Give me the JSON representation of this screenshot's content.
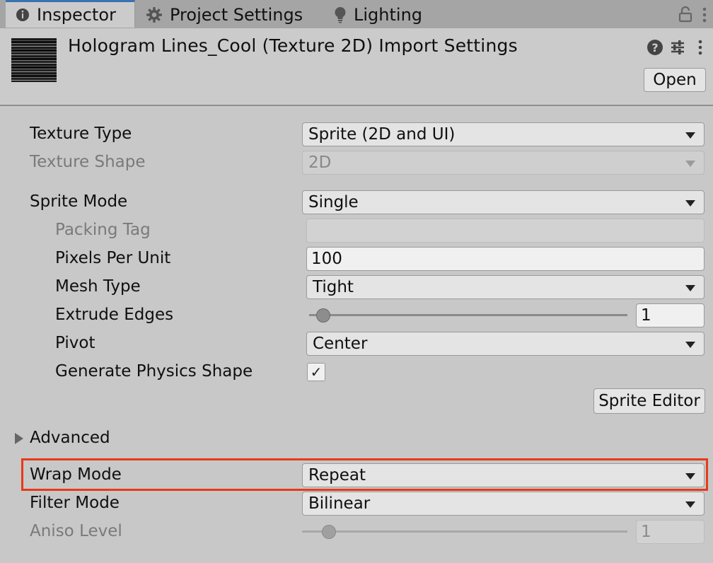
{
  "tabs": [
    {
      "label": "Inspector",
      "icon": "info-icon"
    },
    {
      "label": "Project Settings",
      "icon": "gear-icon"
    },
    {
      "label": "Lighting",
      "icon": "bulb-icon"
    }
  ],
  "header": {
    "title": "Hologram Lines_Cool (Texture 2D) Import Settings",
    "open_label": "Open"
  },
  "fields": {
    "texture_type": {
      "label": "Texture Type",
      "value": "Sprite (2D and UI)"
    },
    "texture_shape": {
      "label": "Texture Shape",
      "value": "2D"
    },
    "sprite_mode": {
      "label": "Sprite Mode",
      "value": "Single"
    },
    "packing_tag": {
      "label": "Packing Tag",
      "value": ""
    },
    "pixels_per_unit": {
      "label": "Pixels Per Unit",
      "value": "100"
    },
    "mesh_type": {
      "label": "Mesh Type",
      "value": "Tight"
    },
    "extrude_edges": {
      "label": "Extrude Edges",
      "value": "1"
    },
    "pivot": {
      "label": "Pivot",
      "value": "Center"
    },
    "generate_physics_shape": {
      "label": "Generate Physics Shape",
      "checked": true,
      "check_glyph": "✓"
    },
    "sprite_editor_label": "Sprite Editor",
    "advanced_label": "Advanced",
    "wrap_mode": {
      "label": "Wrap Mode",
      "value": "Repeat"
    },
    "filter_mode": {
      "label": "Filter Mode",
      "value": "Bilinear"
    },
    "aniso_level": {
      "label": "Aniso Level",
      "value": "1"
    }
  },
  "colors": {
    "highlight": "#e8391a",
    "tab_accent": "#3a72b0"
  }
}
